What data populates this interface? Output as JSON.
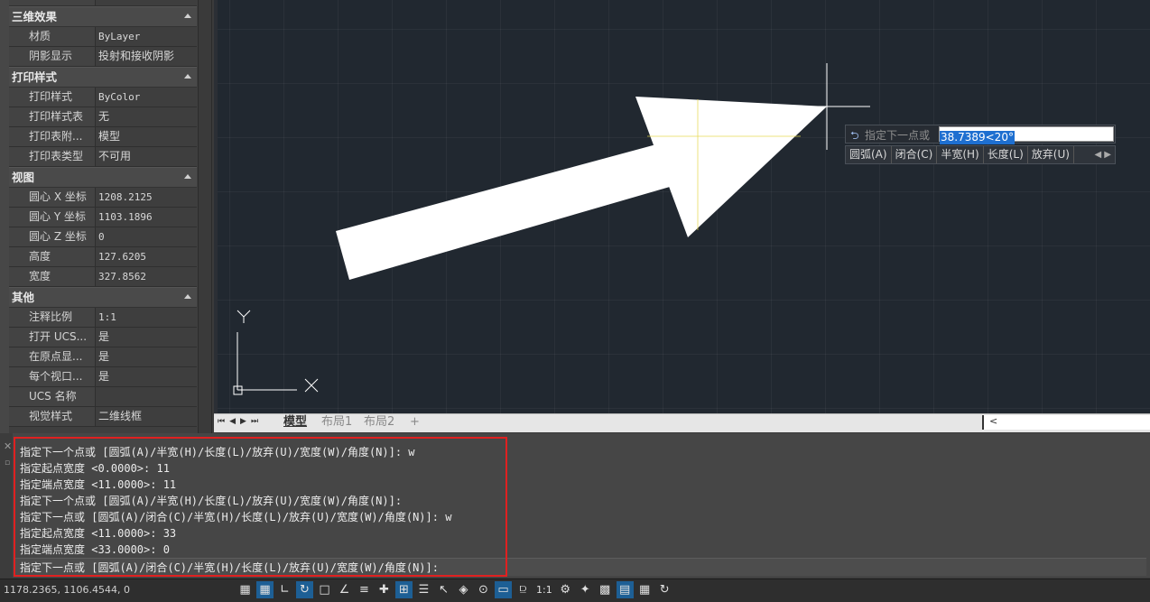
{
  "properties": {
    "sections": [
      {
        "title": "三维效果",
        "rows": [
          {
            "label": "材质",
            "value": "ByLayer"
          },
          {
            "label": "阴影显示",
            "value": "投射和接收阴影"
          }
        ]
      },
      {
        "title": "打印样式",
        "rows": [
          {
            "label": "打印样式",
            "value": "ByColor"
          },
          {
            "label": "打印样式表",
            "value": "无"
          },
          {
            "label": "打印表附...",
            "value": "模型"
          },
          {
            "label": "打印表类型",
            "value": "不可用"
          }
        ]
      },
      {
        "title": "视图",
        "rows": [
          {
            "label": "圆心 X 坐标",
            "value": "1208.2125"
          },
          {
            "label": "圆心 Y 坐标",
            "value": "1103.1896"
          },
          {
            "label": "圆心 Z 坐标",
            "value": "0"
          },
          {
            "label": "高度",
            "value": "127.6205"
          },
          {
            "label": "宽度",
            "value": "327.8562"
          }
        ]
      },
      {
        "title": "其他",
        "rows": [
          {
            "label": "注释比例",
            "value": "1:1"
          },
          {
            "label": "打开 UCS...",
            "value": "是"
          },
          {
            "label": "在原点显...",
            "value": "是"
          },
          {
            "label": "每个视口...",
            "value": "是"
          },
          {
            "label": "UCS 名称",
            "value": ""
          },
          {
            "label": "视觉样式",
            "value": "二维线框"
          }
        ]
      }
    ]
  },
  "canvas": {
    "ucs": {
      "x_label": "X",
      "y_label": "Y"
    }
  },
  "dynamic_input": {
    "prompt": "指定下一点或",
    "value": "38.7389<20°",
    "options": [
      "圆弧(A)",
      "闭合(C)",
      "半宽(H)",
      "长度(L)",
      "放弃(U)"
    ]
  },
  "layout_tabs": {
    "tabs": [
      "模型",
      "布局1",
      "布局2",
      "+"
    ],
    "active": "模型"
  },
  "command": {
    "history": [
      "指定下一个点或 [圆弧(A)/半宽(H)/长度(L)/放弃(U)/宽度(W)/角度(N)]: w",
      "指定起点宽度 <0.0000>: 11",
      "指定端点宽度 <11.0000>: 11",
      "指定下一个点或 [圆弧(A)/半宽(H)/长度(L)/放弃(U)/宽度(W)/角度(N)]:",
      "指定下一点或 [圆弧(A)/闭合(C)/半宽(H)/长度(L)/放弃(U)/宽度(W)/角度(N)]: w",
      "指定起点宽度 <11.0000>: 33",
      "指定端点宽度 <33.0000>: 0"
    ],
    "current": "指定下一点或 [圆弧(A)/闭合(C)/半宽(H)/长度(L)/放弃(U)/宽度(W)/角度(N)]:"
  },
  "status_bar": {
    "coordinates": "1178.2365, 1106.4544, 0",
    "scale": "1:1"
  }
}
